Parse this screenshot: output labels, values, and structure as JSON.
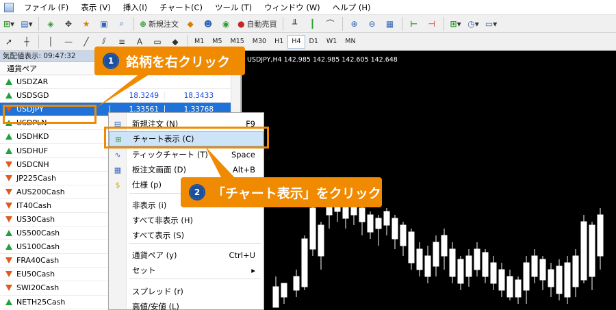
{
  "menubar": [
    "ファイル (F)",
    "表示 (V)",
    "挿入(I)",
    "チャート(C)",
    "ツール (T)",
    "ウィンドウ (W)",
    "ヘルプ (H)"
  ],
  "toolbar": {
    "new_order": "新規注文",
    "auto_trade": "自動売買",
    "timeframes": [
      "M1",
      "M5",
      "M15",
      "M30",
      "H1",
      "H4",
      "D1",
      "W1",
      "MN"
    ],
    "active_timeframe": "H4"
  },
  "market_watch": {
    "title": "気配値表示: 09:47:32",
    "column_header": "通貨ペア",
    "rows": [
      {
        "symbol": "USDZAR",
        "dir": "up",
        "bid": "",
        "ask": ""
      },
      {
        "symbol": "USDSGD",
        "dir": "up",
        "bid": "18.3249",
        "ask": "18.3433",
        "color": "blue"
      },
      {
        "symbol": "USDJPY",
        "dir": "down",
        "bid": "1.33561",
        "ask": "1.33768",
        "color": "red",
        "selected": true
      },
      {
        "symbol": "USDPLN",
        "dir": "up",
        "bid": "",
        "ask": ""
      },
      {
        "symbol": "USDHKD",
        "dir": "up",
        "bid": "",
        "ask": ""
      },
      {
        "symbol": "USDHUF",
        "dir": "up",
        "bid": "",
        "ask": ""
      },
      {
        "symbol": "USDCNH",
        "dir": "down",
        "bid": "",
        "ask": ""
      },
      {
        "symbol": "JP225Cash",
        "dir": "down",
        "bid": "",
        "ask": ""
      },
      {
        "symbol": "AUS200Cash",
        "dir": "down",
        "bid": "",
        "ask": ""
      },
      {
        "symbol": "IT40Cash",
        "dir": "down",
        "bid": "",
        "ask": ""
      },
      {
        "symbol": "US30Cash",
        "dir": "down",
        "bid": "",
        "ask": ""
      },
      {
        "symbol": "US500Cash",
        "dir": "up",
        "bid": "",
        "ask": ""
      },
      {
        "symbol": "US100Cash",
        "dir": "up",
        "bid": "",
        "ask": ""
      },
      {
        "symbol": "FRA40Cash",
        "dir": "down",
        "bid": "",
        "ask": ""
      },
      {
        "symbol": "EU50Cash",
        "dir": "down",
        "bid": "",
        "ask": ""
      },
      {
        "symbol": "SWI20Cash",
        "dir": "down",
        "bid": "",
        "ask": ""
      },
      {
        "symbol": "NETH25Cash",
        "dir": "up",
        "bid": "",
        "ask": ""
      }
    ]
  },
  "chart": {
    "info": "USDJPY,H4  142.985 142.985 142.605 142.648"
  },
  "context_menu": {
    "items": [
      {
        "label": "新規注文 (N)",
        "shortcut": "F9",
        "icon": "new-order-icon"
      },
      {
        "label": "チャート表示 (C)",
        "shortcut": "",
        "icon": "chart-window-icon",
        "highlighted": true
      },
      {
        "label": "ティックチャート (T)",
        "shortcut": "Space",
        "icon": "tick-chart-icon"
      },
      {
        "label": "板注文画面 (D)",
        "shortcut": "Alt+B",
        "icon": "depth-of-market-icon"
      },
      {
        "label": "仕様 (p)",
        "shortcut": "",
        "icon": "specification-icon"
      },
      {
        "label": "非表示 (i)",
        "shortcut": "",
        "icon": ""
      },
      {
        "label": "すべて非表示 (H)",
        "shortcut": "",
        "icon": ""
      },
      {
        "label": "すべて表示 (S)",
        "shortcut": "",
        "icon": ""
      },
      {
        "label": "通貨ペア (y)",
        "shortcut": "Ctrl+U",
        "icon": ""
      },
      {
        "label": "セット",
        "shortcut": "▸",
        "icon": ""
      },
      {
        "label": "スプレッド (r)",
        "shortcut": "",
        "icon": ""
      },
      {
        "label": "高値/安値 (L)",
        "shortcut": "",
        "icon": ""
      }
    ]
  },
  "annotations": {
    "step1": {
      "num": "1",
      "text": "銘柄を右クリック"
    },
    "step2": {
      "num": "2",
      "text": "「チャート表示」をクリック"
    }
  },
  "colors": {
    "accent": "#f08a00",
    "selection": "#1f73d8",
    "chart_bg": "#000000",
    "candle": "#ffffff"
  }
}
